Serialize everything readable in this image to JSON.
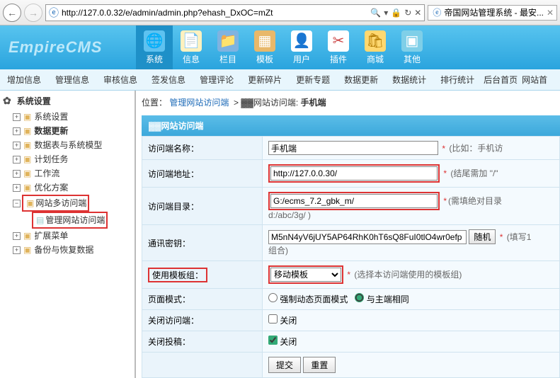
{
  "browser": {
    "url": "http://127.0.0.32/e/admin/admin.php?ehash_DxOC=mZt",
    "tab_title": "帝国网站管理系统 - 最安..."
  },
  "logo_text": "EmpireCMS",
  "toolbar": [
    {
      "label": "系统",
      "icon": "globe",
      "active": true
    },
    {
      "label": "信息",
      "icon": "doc"
    },
    {
      "label": "栏目",
      "icon": "folder"
    },
    {
      "label": "模板",
      "icon": "tpl"
    },
    {
      "label": "用户",
      "icon": "user"
    },
    {
      "label": "插件",
      "icon": "plug"
    },
    {
      "label": "商城",
      "icon": "shop"
    },
    {
      "label": "其他",
      "icon": "other"
    }
  ],
  "submenu": [
    "增加信息",
    "管理信息",
    "审核信息",
    "签发信息",
    "管理评论",
    "更新碎片",
    "更新专题",
    "数据更新",
    "数据统计",
    "排行统计",
    "后台首页",
    "网站首"
  ],
  "sidebar": {
    "title": "系统设置",
    "items": [
      {
        "label": "系统设置",
        "t": "fold"
      },
      {
        "label": "数据更新",
        "t": "fold",
        "bold": true
      },
      {
        "label": "数据表与系统模型",
        "t": "fold"
      },
      {
        "label": "计划任务",
        "t": "fold"
      },
      {
        "label": "工作流",
        "t": "fold"
      },
      {
        "label": "优化方案",
        "t": "fold"
      },
      {
        "label": "网站多访问端",
        "t": "fold",
        "hl": true,
        "open": true,
        "children": [
          {
            "label": "管理网站访问端",
            "t": "file"
          }
        ]
      },
      {
        "label": "扩展菜单",
        "t": "fold"
      },
      {
        "label": "备份与恢复数据",
        "t": "fold"
      }
    ]
  },
  "breadcrumb": {
    "prefix": "位置：",
    "link": "管理网站访问端",
    "mid": "网站访问端:",
    "current": "手机端"
  },
  "panel_title": "网站访问端",
  "form": {
    "name_label": "访问端名称：",
    "name_value": "手机端",
    "name_hint": "(比如：手机访",
    "url_label": "访问端地址：",
    "url_value": "http://127.0.0.30/",
    "url_hint": "(结尾需加 \"/\"",
    "dir_label": "访问端目录：",
    "dir_value": "G:/ecms_7.2_gbk_m/",
    "dir_eg": "d:/abc/3g/ )",
    "dir_hint": "(需填绝对目录",
    "key_label": "通讯密钥：",
    "key_value": "M5nN4yV6jUY5AP64RhK0hT6sQ8FuI0tlO4wr0efp",
    "key_btn": "随机",
    "key_hint": "(填写1",
    "key_hint2": "组合)",
    "tpl_label": "使用模板组：",
    "tpl_value": "移动模板",
    "tpl_hint": "(选择本访问端使用的模板组)",
    "mode_label": "页面模式：",
    "mode_opt1": "强制动态页面模式",
    "mode_opt2": "与主端相同",
    "close_label": "关闭访问端：",
    "close_opt": "关闭",
    "closepost_label": "关闭投稿：",
    "closepost_opt": "关闭",
    "submit": "提交",
    "reset": "重置"
  }
}
